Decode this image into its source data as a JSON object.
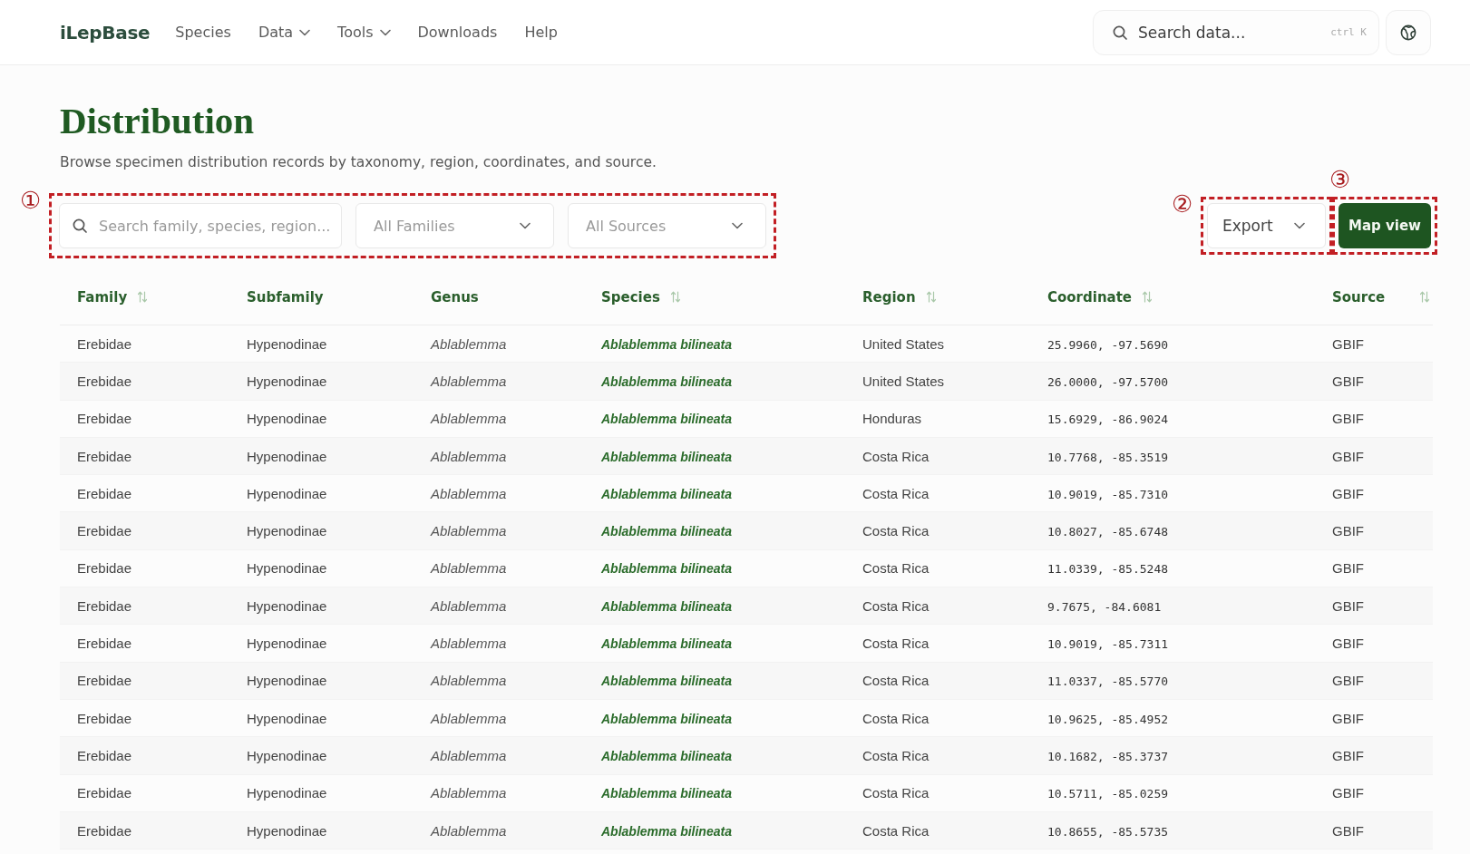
{
  "nav": {
    "logo": "iLepBase",
    "items": [
      {
        "label": "Species",
        "has_menu": false
      },
      {
        "label": "Data",
        "has_menu": true
      },
      {
        "label": "Tools",
        "has_menu": true
      },
      {
        "label": "Downloads",
        "has_menu": false
      },
      {
        "label": "Help",
        "has_menu": false
      }
    ]
  },
  "search": {
    "placeholder": "Search data...",
    "shortcut": "ctrl K"
  },
  "page": {
    "title": "Distribution",
    "subtitle": "Browse specimen distribution records by taxonomy, region, coordinates, and source."
  },
  "filters": {
    "annotation": {
      "label": "①"
    },
    "search_placeholder": "Search family, species, region...",
    "dropdowns": [
      {
        "value": "All Families"
      },
      {
        "value": "All Sources"
      }
    ]
  },
  "actions": [
    {
      "kind": "dropdown",
      "label": "Export",
      "annotation": {
        "label": "②"
      }
    },
    {
      "kind": "primary",
      "label": "Map view",
      "annotation": {
        "label": "③"
      }
    }
  ],
  "table": {
    "columns": [
      {
        "label": "Family",
        "sortable": true,
        "kind": "text"
      },
      {
        "label": "Subfamily",
        "sortable": false,
        "kind": "text"
      },
      {
        "label": "Genus",
        "sortable": false,
        "kind": "italic"
      },
      {
        "label": "Species",
        "sortable": true,
        "kind": "taxon"
      },
      {
        "label": "Region",
        "sortable": true,
        "kind": "text"
      },
      {
        "label": "Coordinate",
        "sortable": true,
        "kind": "mono"
      },
      {
        "label": "Source",
        "sortable": true,
        "kind": "text"
      }
    ],
    "rows": [
      [
        "Erebidae",
        "Hypenodinae",
        "Ablablemma",
        "Ablablemma bilineata",
        "United States",
        "25.9960, -97.5690",
        "GBIF"
      ],
      [
        "Erebidae",
        "Hypenodinae",
        "Ablablemma",
        "Ablablemma bilineata",
        "United States",
        "26.0000, -97.5700",
        "GBIF"
      ],
      [
        "Erebidae",
        "Hypenodinae",
        "Ablablemma",
        "Ablablemma bilineata",
        "Honduras",
        "15.6929, -86.9024",
        "GBIF"
      ],
      [
        "Erebidae",
        "Hypenodinae",
        "Ablablemma",
        "Ablablemma bilineata",
        "Costa Rica",
        "10.7768, -85.3519",
        "GBIF"
      ],
      [
        "Erebidae",
        "Hypenodinae",
        "Ablablemma",
        "Ablablemma bilineata",
        "Costa Rica",
        "10.9019, -85.7310",
        "GBIF"
      ],
      [
        "Erebidae",
        "Hypenodinae",
        "Ablablemma",
        "Ablablemma bilineata",
        "Costa Rica",
        "10.8027, -85.6748",
        "GBIF"
      ],
      [
        "Erebidae",
        "Hypenodinae",
        "Ablablemma",
        "Ablablemma bilineata",
        "Costa Rica",
        "11.0339, -85.5248",
        "GBIF"
      ],
      [
        "Erebidae",
        "Hypenodinae",
        "Ablablemma",
        "Ablablemma bilineata",
        "Costa Rica",
        "9.7675, -84.6081",
        "GBIF"
      ],
      [
        "Erebidae",
        "Hypenodinae",
        "Ablablemma",
        "Ablablemma bilineata",
        "Costa Rica",
        "10.9019, -85.7311",
        "GBIF"
      ],
      [
        "Erebidae",
        "Hypenodinae",
        "Ablablemma",
        "Ablablemma bilineata",
        "Costa Rica",
        "11.0337, -85.5770",
        "GBIF"
      ],
      [
        "Erebidae",
        "Hypenodinae",
        "Ablablemma",
        "Ablablemma bilineata",
        "Costa Rica",
        "10.9625, -85.4952",
        "GBIF"
      ],
      [
        "Erebidae",
        "Hypenodinae",
        "Ablablemma",
        "Ablablemma bilineata",
        "Costa Rica",
        "10.1682, -85.3737",
        "GBIF"
      ],
      [
        "Erebidae",
        "Hypenodinae",
        "Ablablemma",
        "Ablablemma bilineata",
        "Costa Rica",
        "10.5711, -85.0259",
        "GBIF"
      ],
      [
        "Erebidae",
        "Hypenodinae",
        "Ablablemma",
        "Ablablemma bilineata",
        "Costa Rica",
        "10.8655, -85.5735",
        "GBIF"
      ]
    ]
  }
}
